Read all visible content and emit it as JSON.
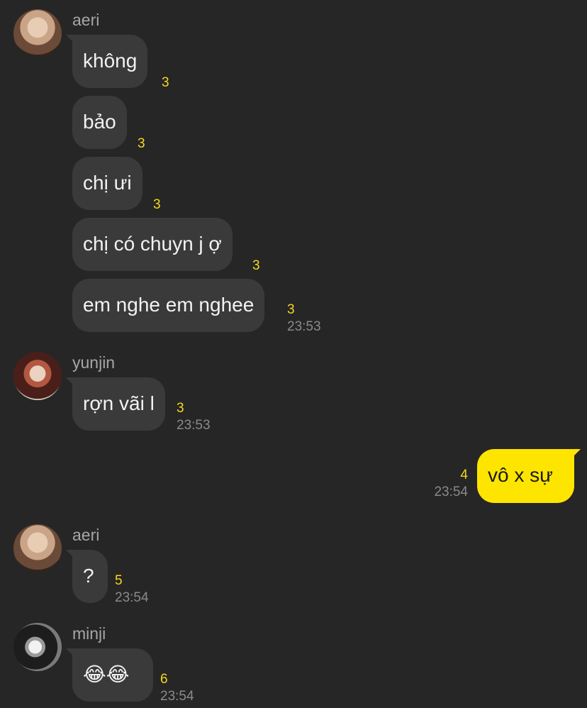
{
  "messages": [
    {
      "sender": "aeri",
      "text": "không",
      "unread": "3"
    },
    {
      "text": "bảo",
      "unread": "3"
    },
    {
      "text": "chị ưi",
      "unread": "3"
    },
    {
      "text": "chị có chuyn j ợ",
      "unread": "3"
    },
    {
      "text": "em nghe em nghee",
      "unread": "3",
      "time": "23:53"
    },
    {
      "sender": "yunjin",
      "text": "rợn vãi l",
      "unread": "3",
      "time": "23:53"
    },
    {
      "sender": "me",
      "text": "vô x sự",
      "unread": "4",
      "time": "23:54"
    },
    {
      "sender": "aeri",
      "text": "?",
      "unread": "5",
      "time": "23:54"
    },
    {
      "sender": "minji",
      "text": "😂😂",
      "unread": "6",
      "time": "23:54"
    }
  ],
  "senders": {
    "aeri": "aeri",
    "yunjin": "yunjin",
    "minji": "minji"
  },
  "colors": {
    "background": "#262626",
    "incoming_bubble": "#3a3a3b",
    "outgoing_bubble": "#fee500",
    "unread_count": "#f5d71f",
    "timestamp": "#8a8a8a"
  }
}
